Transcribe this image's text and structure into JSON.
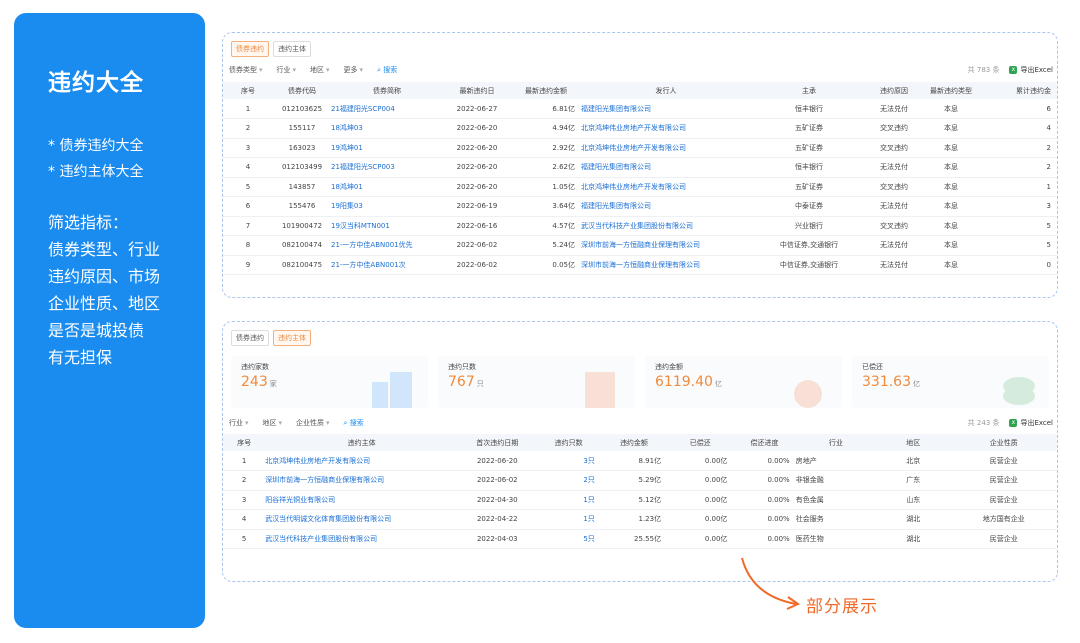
{
  "sidebar": {
    "title": "违约大全",
    "items": [
      "* 债券违约大全",
      "* 违约主体大全"
    ],
    "filter_title": "筛选指标：",
    "filters": [
      "债券类型、行业",
      "违约原因、市场",
      "企业性质、地区",
      "是否是城投债",
      "有无担保"
    ]
  },
  "panel1": {
    "tabs": [
      "债券违约",
      "违约主体"
    ],
    "active_tab": 0,
    "filters": [
      "债券类型",
      "行业",
      "地区",
      "更多"
    ],
    "search_label": "搜索",
    "total": "共 783 条",
    "export_label": "导出Excel",
    "columns": [
      "序号",
      "债券代码",
      "债券简称",
      "最新违约日",
      "最新违约金额",
      "发行人",
      "主承",
      "违约原因",
      "最新违约类型",
      "累计违约金"
    ],
    "rows": [
      [
        "1",
        "012103625",
        "21福建阳光SCP004",
        "2022-06-27",
        "6.81亿",
        "福建阳光集团有限公司",
        "恒丰银行",
        "无法兑付",
        "本息",
        "6"
      ],
      [
        "2",
        "155117",
        "18鸿坤03",
        "2022-06-20",
        "4.94亿",
        "北京鸿坤伟业房地产开发有限公司",
        "五矿证券",
        "交叉违约",
        "本息",
        "4"
      ],
      [
        "3",
        "163023",
        "19鸿坤01",
        "2022-06-20",
        "2.92亿",
        "北京鸿坤伟业房地产开发有限公司",
        "五矿证券",
        "交叉违约",
        "本息",
        "2"
      ],
      [
        "4",
        "012103499",
        "21福建阳光SCP003",
        "2022-06-20",
        "2.62亿",
        "福建阳光集团有限公司",
        "恒丰银行",
        "无法兑付",
        "本息",
        "2"
      ],
      [
        "5",
        "143857",
        "18鸿坤01",
        "2022-06-20",
        "1.05亿",
        "北京鸿坤伟业房地产开发有限公司",
        "五矿证券",
        "交叉违约",
        "本息",
        "1"
      ],
      [
        "6",
        "155476",
        "19阳集03",
        "2022-06-19",
        "3.64亿",
        "福建阳光集团有限公司",
        "中泰证券",
        "无法兑付",
        "本息",
        "3"
      ],
      [
        "7",
        "101900472",
        "19汉当科MTN001",
        "2022-06-16",
        "4.57亿",
        "武汉当代科技产业集团股份有限公司",
        "兴业银行",
        "交叉违约",
        "本息",
        "5"
      ],
      [
        "8",
        "082100474",
        "21-一方中佳ABN001优先",
        "2022-06-02",
        "5.24亿",
        "深圳市前海一方恒融商业保理有限公司",
        "中信证券,交通银行",
        "无法兑付",
        "本息",
        "5"
      ],
      [
        "9",
        "082100475",
        "21-一方中佳ABN001次",
        "2022-06-02",
        "0.05亿",
        "深圳市前海一方恒融商业保理有限公司",
        "中信证券,交通银行",
        "无法兑付",
        "本息",
        "0"
      ]
    ]
  },
  "panel2": {
    "tabs": [
      "债券违约",
      "违约主体"
    ],
    "active_tab": 1,
    "stats": [
      {
        "label": "违约家数",
        "value": "243",
        "unit": "家"
      },
      {
        "label": "违约只数",
        "value": "767",
        "unit": "只"
      },
      {
        "label": "违约金额",
        "value": "6119.40",
        "unit": "亿"
      },
      {
        "label": "已偿还",
        "value": "331.63",
        "unit": "亿"
      }
    ],
    "filters": [
      "行业",
      "地区",
      "企业性质"
    ],
    "search_label": "搜索",
    "total": "共 243 条",
    "export_label": "导出Excel",
    "columns": [
      "序号",
      "违约主体",
      "首次违约日期",
      "违约只数",
      "违约金额",
      "已偿还",
      "偿还进度",
      "行业",
      "地区",
      "企业性质"
    ],
    "rows": [
      [
        "1",
        "北京鸿坤伟业房地产开发有限公司",
        "2022-06-20",
        "3只",
        "8.91亿",
        "0.00亿",
        "0.00%",
        "房地产",
        "北京",
        "民营企业"
      ],
      [
        "2",
        "深圳市前海一方恒融商业保理有限公司",
        "2022-06-02",
        "2只",
        "5.29亿",
        "0.00亿",
        "0.00%",
        "非银金融",
        "广东",
        "民营企业"
      ],
      [
        "3",
        "阳谷祥光铜业有限公司",
        "2022-04-30",
        "1只",
        "5.12亿",
        "0.00亿",
        "0.00%",
        "有色金属",
        "山东",
        "民营企业"
      ],
      [
        "4",
        "武汉当代明诚文化体育集团股份有限公司",
        "2022-04-22",
        "1只",
        "1.23亿",
        "0.00亿",
        "0.00%",
        "社会服务",
        "湖北",
        "地方国有企业"
      ],
      [
        "5",
        "武汉当代科技产业集团股份有限公司",
        "2022-04-03",
        "5只",
        "25.55亿",
        "0.00亿",
        "0.00%",
        "医药生物",
        "湖北",
        "民营企业"
      ]
    ]
  },
  "callout": "部分展示",
  "colors": {
    "sidebar": "#1a8cf0",
    "accent": "#f08a3c",
    "link": "#1a6fd4",
    "callout": "#f06a2a"
  }
}
